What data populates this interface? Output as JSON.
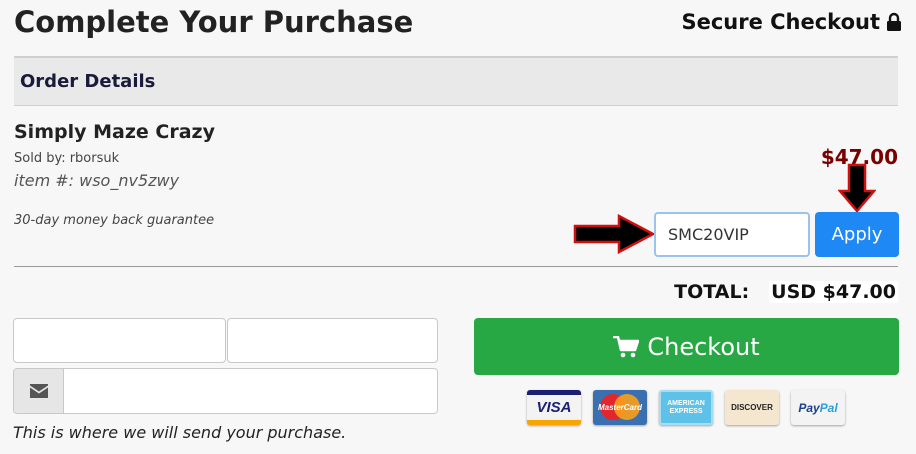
{
  "header": {
    "title": "Complete Your Purchase",
    "secure_label": "Secure Checkout"
  },
  "order": {
    "section_title": "Order Details",
    "product_name": "Simply Maze Crazy",
    "sold_by": "Sold by: rborsuk",
    "item_number": "item #: wso_nv5zwy",
    "guarantee": "30-day money back guarantee",
    "price": "$47.00"
  },
  "coupon": {
    "value": "SMC20VIP",
    "apply_label": "Apply"
  },
  "total": {
    "label": "TOTAL:",
    "value": "USD $47.00"
  },
  "form": {
    "first_name_value": "",
    "last_name_value": "",
    "email_value": "",
    "note": "This is where we will send your purchase."
  },
  "checkout": {
    "label": "Checkout"
  },
  "payment_cards": [
    {
      "name": "VISA",
      "icon": "visa-card-icon"
    },
    {
      "name": "MasterCard",
      "icon": "mastercard-icon"
    },
    {
      "name": "AMERICAN EXPRESS",
      "icon": "amex-card-icon"
    },
    {
      "name": "DISCOVER",
      "icon": "discover-card-icon"
    },
    {
      "name_part1": "Pay",
      "name_part2": "Pal",
      "icon": "paypal-icon"
    }
  ],
  "colors": {
    "price": "#7a0000",
    "apply_button": "#1e88f5",
    "checkout_button": "#28a745",
    "annotation_arrow": "#000000",
    "annotation_arrow_outline": "#d01010"
  }
}
